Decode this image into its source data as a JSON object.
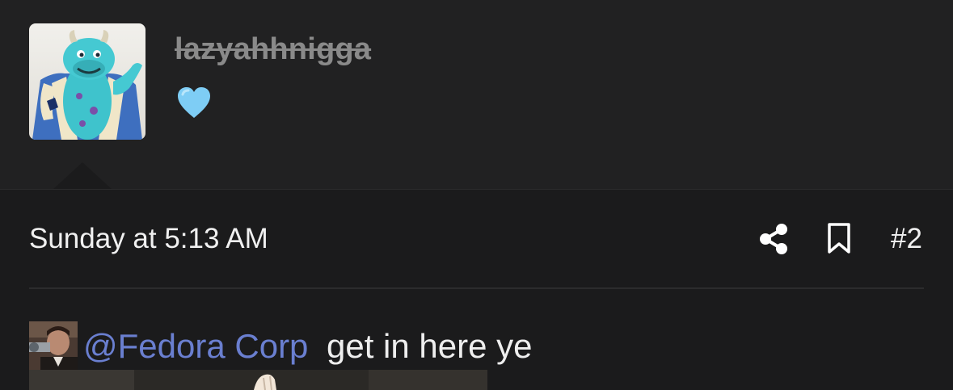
{
  "user": {
    "username": "lazyahhnigga",
    "title_icon": "blue-heart-emoji",
    "avatar_icon": "blue-monster-character-avatar"
  },
  "post": {
    "date": "Sunday at 5:13 AM",
    "number": "#2",
    "share_icon": "share-icon",
    "bookmark_icon": "bookmark-icon",
    "mention": "@Fedora Corp",
    "text": "get in here ye",
    "mention_avatar_icon": "user-avatar-thumbnail"
  },
  "colors": {
    "background": "#1b1b1c",
    "header_background": "#212122",
    "username": "#8a8a8a",
    "mention_link": "#6a7fd0",
    "text": "#eeeeee",
    "heart": "#7ecdf5"
  }
}
